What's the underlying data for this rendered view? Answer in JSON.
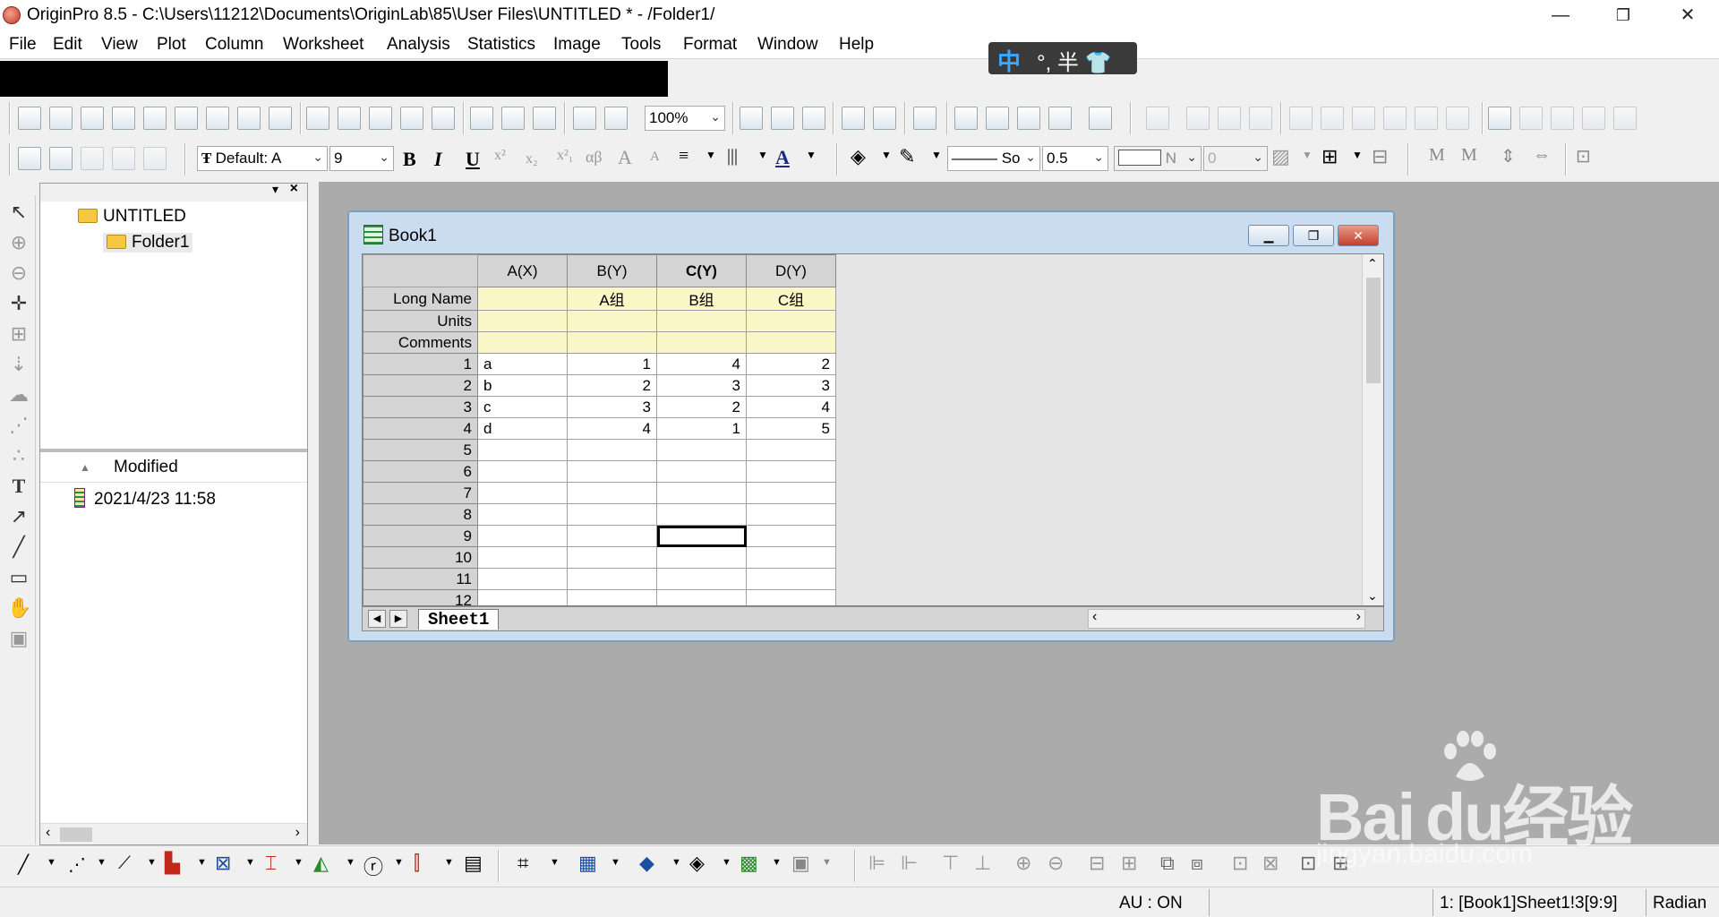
{
  "window": {
    "title": "OriginPro 8.5 - C:\\Users\\11212\\Documents\\OriginLab\\85\\User Files\\UNTITLED * - /Folder1/",
    "min_glyph": "—",
    "max_glyph": "❐",
    "close_glyph": "✕"
  },
  "menu": [
    "File",
    "Edit",
    "View",
    "Plot",
    "Column",
    "Worksheet",
    "Analysis",
    "Statistics",
    "Image",
    "Tools",
    "Format",
    "Window",
    "Help"
  ],
  "ime": {
    "mode": "中",
    "rest": "°, 半 👕"
  },
  "toolbar": {
    "zoom": "100%",
    "font": "Default: A",
    "font_size": "9",
    "bold": "B",
    "italic": "I",
    "underline": "U",
    "line_style": "——— So",
    "line_width": "0.5",
    "fill_label": "N",
    "value_zero": "0"
  },
  "explorer": {
    "root": "UNTITLED",
    "child": "Folder1",
    "column_header": "Modified",
    "modified_value": "2021/4/23 11:58"
  },
  "book": {
    "title": "Book1",
    "columns": [
      "A(X)",
      "B(Y)",
      "C(Y)",
      "D(Y)"
    ],
    "meta_rows": [
      {
        "label": "Long Name",
        "values": [
          "",
          "A组",
          "B组",
          "C组"
        ]
      },
      {
        "label": "Units",
        "values": [
          "",
          "",
          "",
          ""
        ]
      },
      {
        "label": "Comments",
        "values": [
          "",
          "",
          "",
          ""
        ]
      }
    ],
    "rows": [
      {
        "n": "1",
        "values": [
          "a",
          "1",
          "4",
          "2"
        ]
      },
      {
        "n": "2",
        "values": [
          "b",
          "2",
          "3",
          "3"
        ]
      },
      {
        "n": "3",
        "values": [
          "c",
          "3",
          "2",
          "4"
        ]
      },
      {
        "n": "4",
        "values": [
          "d",
          "4",
          "1",
          "5"
        ]
      },
      {
        "n": "5",
        "values": [
          "",
          "",
          "",
          ""
        ]
      },
      {
        "n": "6",
        "values": [
          "",
          "",
          "",
          ""
        ]
      },
      {
        "n": "7",
        "values": [
          "",
          "",
          "",
          ""
        ]
      },
      {
        "n": "8",
        "values": [
          "",
          "",
          "",
          ""
        ]
      },
      {
        "n": "9",
        "values": [
          "",
          "",
          "",
          ""
        ]
      },
      {
        "n": "10",
        "values": [
          "",
          "",
          "",
          ""
        ]
      },
      {
        "n": "11",
        "values": [
          "",
          "",
          "",
          ""
        ]
      },
      {
        "n": "12",
        "values": [
          "",
          "",
          "",
          ""
        ]
      }
    ],
    "sheet_tab": "Sheet1"
  },
  "status": {
    "au": "AU : ON",
    "cell": "1: [Book1]Sheet1!3[9:9]",
    "angle": "Radian"
  },
  "watermark": {
    "brand": "Bai du经验",
    "site": "jingyan.baidu.com"
  }
}
